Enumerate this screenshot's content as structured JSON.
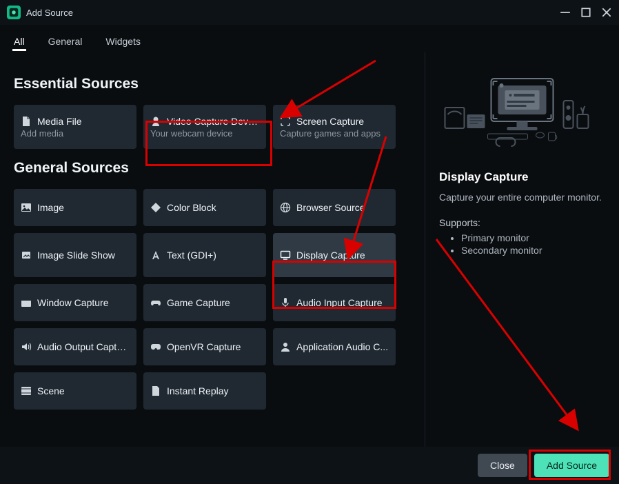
{
  "window": {
    "title": "Add Source"
  },
  "tabs": {
    "items": [
      {
        "label": "All",
        "active": true
      },
      {
        "label": "General",
        "active": false
      },
      {
        "label": "Widgets",
        "active": false
      }
    ]
  },
  "sections": {
    "essential": {
      "title": "Essential Sources",
      "cards": [
        {
          "icon": "file-icon",
          "label": "Media File",
          "sub": "Add media"
        },
        {
          "icon": "camera-icon",
          "label": "Video Capture Device",
          "sub": "Your webcam device"
        },
        {
          "icon": "crop-icon",
          "label": "Screen Capture",
          "sub": "Capture games and apps"
        }
      ]
    },
    "general": {
      "title": "General Sources",
      "cards": [
        {
          "icon": "image-icon",
          "label": "Image"
        },
        {
          "icon": "color-icon",
          "label": "Color Block"
        },
        {
          "icon": "globe-icon",
          "label": "Browser Source"
        },
        {
          "icon": "slideshow-icon",
          "label": "Image Slide Show"
        },
        {
          "icon": "text-icon",
          "label": "Text (GDI+)"
        },
        {
          "icon": "display-icon",
          "label": "Display Capture",
          "selected": true
        },
        {
          "icon": "window-icon",
          "label": "Window Capture"
        },
        {
          "icon": "game-icon",
          "label": "Game Capture"
        },
        {
          "icon": "mic-icon",
          "label": "Audio Input Capture"
        },
        {
          "icon": "speaker-icon",
          "label": "Audio Output Capture"
        },
        {
          "icon": "vr-icon",
          "label": "OpenVR Capture"
        },
        {
          "icon": "person-icon",
          "label": "Application Audio C..."
        },
        {
          "icon": "scene-icon",
          "label": "Scene"
        },
        {
          "icon": "replay-icon",
          "label": "Instant Replay"
        }
      ]
    }
  },
  "preview": {
    "title": "Display Capture",
    "description": "Capture your entire computer monitor.",
    "supports_title": "Supports:",
    "supports": [
      "Primary monitor",
      "Secondary monitor"
    ]
  },
  "footer": {
    "close": "Close",
    "add": "Add Source"
  },
  "colors": {
    "accent": "#4de2b7",
    "annotation": "#d90000",
    "card": "#202932",
    "card_selected": "#2f3a44",
    "bg": "#0a0d10"
  },
  "chart_data": null
}
